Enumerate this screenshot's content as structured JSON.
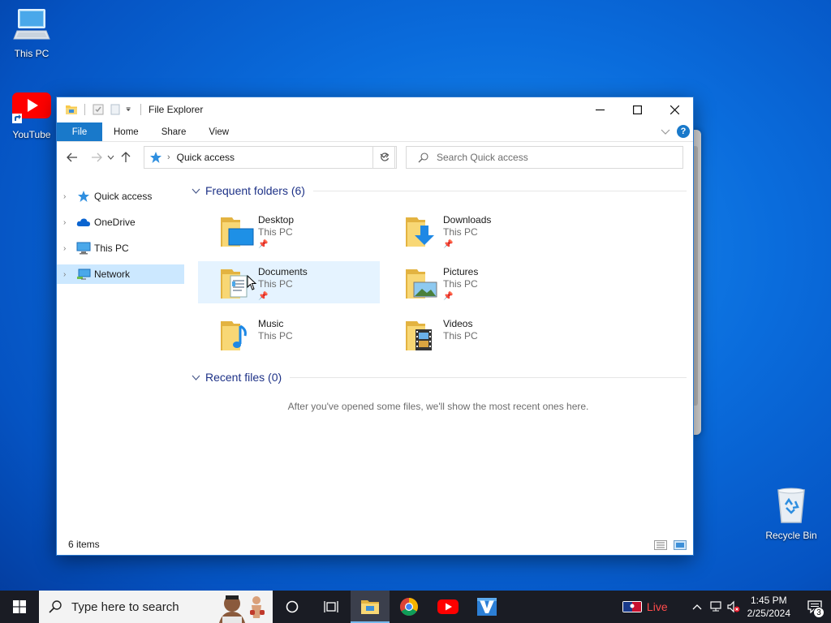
{
  "desktop": {
    "icons": [
      {
        "label": "This PC"
      },
      {
        "label": "YouTube"
      },
      {
        "label": "Recycle Bin"
      }
    ]
  },
  "window": {
    "title": "File Explorer",
    "ribbon_tabs": [
      "File",
      "Home",
      "Share",
      "View"
    ],
    "address": {
      "location": "Quick access"
    },
    "search": {
      "placeholder": "Search Quick access"
    },
    "nav_pane": [
      {
        "label": "Quick access"
      },
      {
        "label": "OneDrive"
      },
      {
        "label": "This PC"
      },
      {
        "label": "Network"
      }
    ],
    "frequent": {
      "header": "Frequent folders (6)",
      "folders": [
        {
          "name": "Desktop",
          "location": "This PC"
        },
        {
          "name": "Downloads",
          "location": "This PC"
        },
        {
          "name": "Documents",
          "location": "This PC"
        },
        {
          "name": "Pictures",
          "location": "This PC"
        },
        {
          "name": "Music",
          "location": "This PC"
        },
        {
          "name": "Videos",
          "location": "This PC"
        }
      ]
    },
    "recent": {
      "header": "Recent files (0)",
      "empty_message": "After you've opened some files, we'll show the most recent ones here."
    },
    "status": {
      "item_count": "6 items"
    }
  },
  "taskbar": {
    "search_placeholder": "Type here to search",
    "live_label": "Live",
    "time": "1:45 PM",
    "date": "2/25/2024",
    "notification_count": "3"
  },
  "colors": {
    "accent": "#1979ca",
    "selection": "#cce8ff",
    "hover": "#e5f3ff",
    "group_header": "#1e3287",
    "folder_yellow": "#f8d775"
  }
}
